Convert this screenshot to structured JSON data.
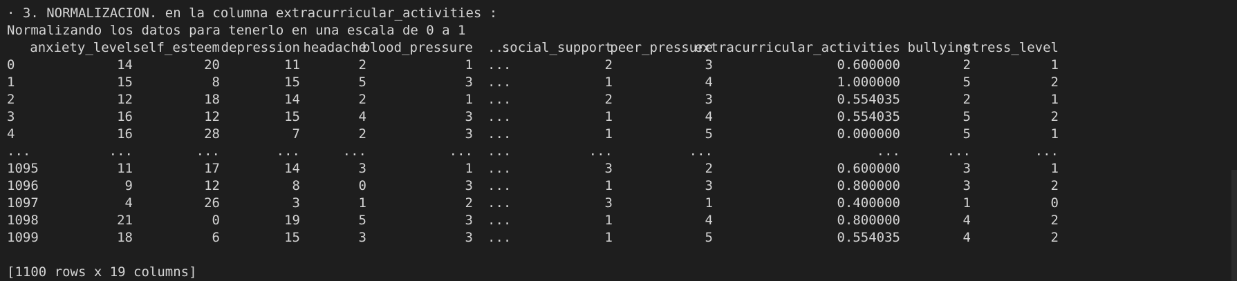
{
  "terminal": {
    "heading_line": "· 3. NORMALIZACION. en la columna extracurricular_activities :",
    "subheading_line": "Normalizando los datos para tenerlo en una escala de 0 a 1",
    "footer_line": "[1100 rows x 19 columns]"
  },
  "table": {
    "columns": [
      "anxiety_level",
      "self_esteem",
      "depression",
      "headache",
      "blood_pressure",
      "...",
      "social_support",
      "peer_pressure",
      "extracurricular_activities",
      "bullying",
      "stress_level"
    ],
    "rows": [
      {
        "index": "0",
        "values": [
          "14",
          "20",
          "11",
          "2",
          "1",
          "...",
          "2",
          "3",
          "0.600000",
          "2",
          "1"
        ]
      },
      {
        "index": "1",
        "values": [
          "15",
          "8",
          "15",
          "5",
          "3",
          "...",
          "1",
          "4",
          "1.000000",
          "5",
          "2"
        ]
      },
      {
        "index": "2",
        "values": [
          "12",
          "18",
          "14",
          "2",
          "1",
          "...",
          "2",
          "3",
          "0.554035",
          "2",
          "1"
        ]
      },
      {
        "index": "3",
        "values": [
          "16",
          "12",
          "15",
          "4",
          "3",
          "...",
          "1",
          "4",
          "0.554035",
          "5",
          "2"
        ]
      },
      {
        "index": "4",
        "values": [
          "16",
          "28",
          "7",
          "2",
          "3",
          "...",
          "1",
          "5",
          "0.000000",
          "5",
          "1"
        ]
      },
      {
        "index": "...",
        "values": [
          "...",
          "...",
          "...",
          "...",
          "...",
          "...",
          "...",
          "...",
          "...",
          "...",
          "..."
        ]
      },
      {
        "index": "1095",
        "values": [
          "11",
          "17",
          "14",
          "3",
          "1",
          "...",
          "3",
          "2",
          "0.600000",
          "3",
          "1"
        ]
      },
      {
        "index": "1096",
        "values": [
          "9",
          "12",
          "8",
          "0",
          "3",
          "...",
          "1",
          "3",
          "0.800000",
          "3",
          "2"
        ]
      },
      {
        "index": "1097",
        "values": [
          "4",
          "26",
          "3",
          "1",
          "2",
          "...",
          "3",
          "1",
          "0.400000",
          "1",
          "0"
        ]
      },
      {
        "index": "1098",
        "values": [
          "21",
          "0",
          "19",
          "5",
          "3",
          "...",
          "1",
          "4",
          "0.800000",
          "4",
          "2"
        ]
      },
      {
        "index": "1099",
        "values": [
          "18",
          "6",
          "15",
          "3",
          "3",
          "...",
          "1",
          "5",
          "0.554035",
          "4",
          "2"
        ]
      }
    ]
  }
}
